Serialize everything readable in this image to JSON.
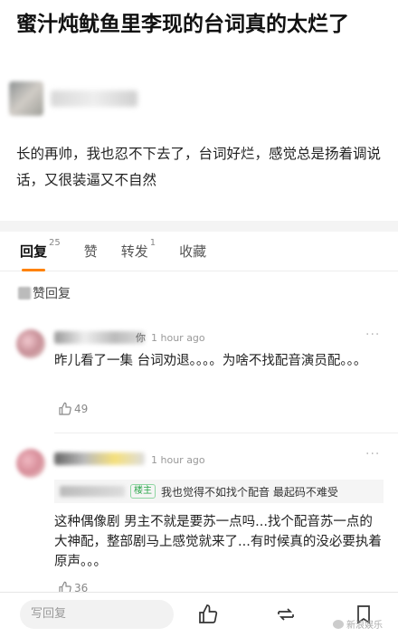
{
  "post": {
    "title": "蜜汁炖鱿鱼里李现的台词真的太烂了",
    "body": "长的再帅，我也忍不下去了，台词好烂，感觉总是扬着调说话，又很装逼又不自然"
  },
  "tabs": [
    {
      "label": "回复",
      "count": "25"
    },
    {
      "label": "赞",
      "count": ""
    },
    {
      "label": "转发",
      "count": "1"
    },
    {
      "label": "收藏",
      "count": ""
    }
  ],
  "hot_header": "赞回复",
  "comments": [
    {
      "name_tail": "你",
      "time": "1 hour ago",
      "text": "昨儿看了一集 台词劝退。。。。为啥不找配音演员配。。。",
      "likes": "49"
    },
    {
      "time": "1 hour ago",
      "quote_badge": "楼主",
      "quote_text": "我也觉得不如找个配音 最起码不难受",
      "text": "这种偶像剧 男主不就是要苏一点吗...找个配音苏一点的大神配，整部剧马上感觉就来了...有时候真的没必要执着原声。。。",
      "likes": "36"
    }
  ],
  "bottom_bar": {
    "reply_placeholder": "写回复"
  },
  "watermark": "新浪娱乐"
}
